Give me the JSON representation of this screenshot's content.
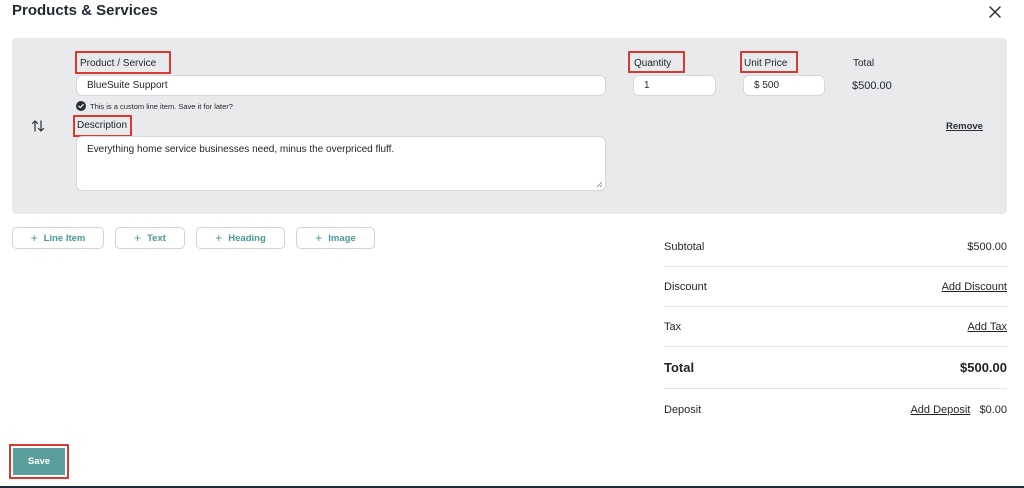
{
  "header": {
    "title": "Products & Services",
    "close_icon": "close-icon"
  },
  "line_item": {
    "product_label": "Product / Service",
    "product_value": "BlueSuite Support",
    "custom_note": "This is a custom line item. Save it for later?",
    "description_label": "Description",
    "description_value": "Everything home service businesses need, minus the overpriced fluff.",
    "quantity_label": "Quantity",
    "quantity_value": "1",
    "unit_price_label": "Unit Price",
    "unit_price_value": "$ 500",
    "total_label": "Total",
    "total_value": "$500.00",
    "remove_label": "Remove",
    "reorder_icon": "reorder-arrows-icon"
  },
  "add_buttons": {
    "line_item": "Line Item",
    "text": "Text",
    "heading": "Heading",
    "image": "Image"
  },
  "summary": {
    "subtotal_label": "Subtotal",
    "subtotal_value": "$500.00",
    "discount_label": "Discount",
    "discount_link": "Add Discount",
    "tax_label": "Tax",
    "tax_link": "Add Tax",
    "total_label": "Total",
    "total_value": "$500.00",
    "deposit_label": "Deposit",
    "deposit_link": "Add Deposit",
    "deposit_value": "$0.00"
  },
  "footer": {
    "save_label": "Save"
  },
  "colors": {
    "accent": "#5a9f9b",
    "accent_text": "#4a9a96",
    "highlight_border": "#d63b32",
    "card_bg": "#e9eaec"
  }
}
